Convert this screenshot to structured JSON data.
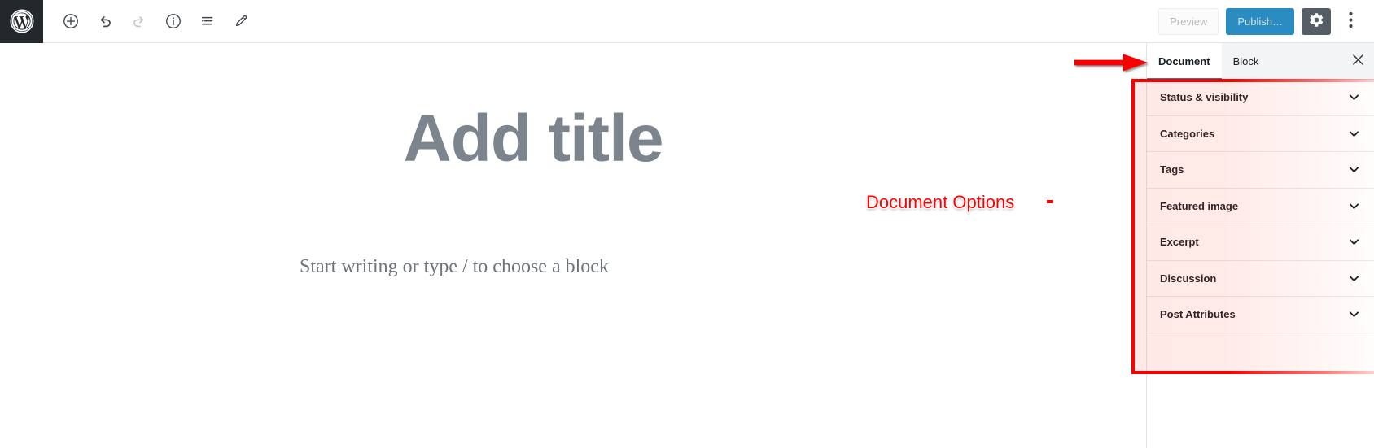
{
  "app": {
    "name": "WordPress Block Editor",
    "logo_icon": "wordpress-logo-icon"
  },
  "toolbar": {
    "left_tools": [
      {
        "id": "add-block",
        "icon": "plus-circle-icon",
        "label": "Add block",
        "disabled": false
      },
      {
        "id": "undo",
        "icon": "undo-icon",
        "label": "Undo",
        "disabled": false
      },
      {
        "id": "redo",
        "icon": "redo-icon",
        "label": "Redo",
        "disabled": true
      },
      {
        "id": "info",
        "icon": "info-circle-icon",
        "label": "Content structure",
        "disabled": false
      },
      {
        "id": "list-view",
        "icon": "list-view-icon",
        "label": "Block navigation",
        "disabled": false
      },
      {
        "id": "edit-mode",
        "icon": "pencil-icon",
        "label": "Edit",
        "disabled": false
      }
    ],
    "preview_label": "Preview",
    "publish_label": "Publish…",
    "settings_icon": "gear-icon",
    "more_menu_icon": "kebab-menu-icon"
  },
  "editor": {
    "title_placeholder": "Add title",
    "body_placeholder": "Start writing or type / to choose a block"
  },
  "sidebar": {
    "tabs": [
      {
        "label": "Document",
        "active": true
      },
      {
        "label": "Block",
        "active": false
      }
    ],
    "close_icon": "close-icon",
    "panels": [
      {
        "label": "Status & visibility",
        "chevron": "chevron-down-icon"
      },
      {
        "label": "Categories",
        "chevron": "chevron-down-icon"
      },
      {
        "label": "Tags",
        "chevron": "chevron-down-icon"
      },
      {
        "label": "Featured image",
        "chevron": "chevron-down-icon"
      },
      {
        "label": "Excerpt",
        "chevron": "chevron-down-icon"
      },
      {
        "label": "Discussion",
        "chevron": "chevron-down-icon"
      },
      {
        "label": "Post Attributes",
        "chevron": "chevron-down-icon"
      }
    ]
  },
  "annotation": {
    "label": "Document Options",
    "color": "#ff0000",
    "arrow_icon": "right-arrow-icon",
    "highlight_color": "#fb0000"
  },
  "colors": {
    "wp_logo_bg": "#23282d",
    "publish_blue": "#2a8cc0",
    "gear_active": "#555d66",
    "tab_underline": "#2a7fa8",
    "title_grey": "#7c848d",
    "annotation_red": "#ff0000"
  }
}
